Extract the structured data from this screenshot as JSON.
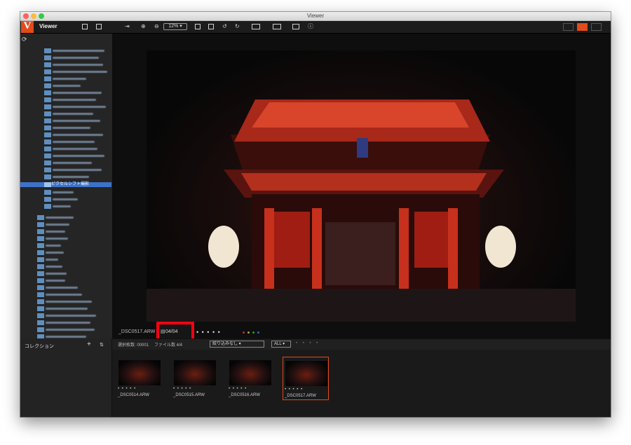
{
  "window": {
    "title": "Viewer"
  },
  "app": {
    "name": "Viewer",
    "logo_letter": "V",
    "brand_color": "#e24b1a"
  },
  "toolbar": {
    "zoom": "12%"
  },
  "sidebar": {
    "selected_folder": "ピクセルシフト撮影"
  },
  "viewer": {
    "filename": "_DSC0517.ARW",
    "counter": "04/04"
  },
  "collection": {
    "title": "コレクション"
  },
  "filmbar": {
    "selected": "選択枚数: 00001",
    "file_count": "ファイル数 4/4",
    "filter": "絞り込みなし",
    "rating_filter": "ALL"
  },
  "thumbnails": [
    {
      "name": "_DSC0514.ARW"
    },
    {
      "name": "_DSC0515.ARW"
    },
    {
      "name": "_DSC0516.ARW"
    },
    {
      "name": "_DSC0517.ARW"
    }
  ],
  "colors": {
    "highlight": "#ff0010",
    "selection": "#3d72c9"
  }
}
